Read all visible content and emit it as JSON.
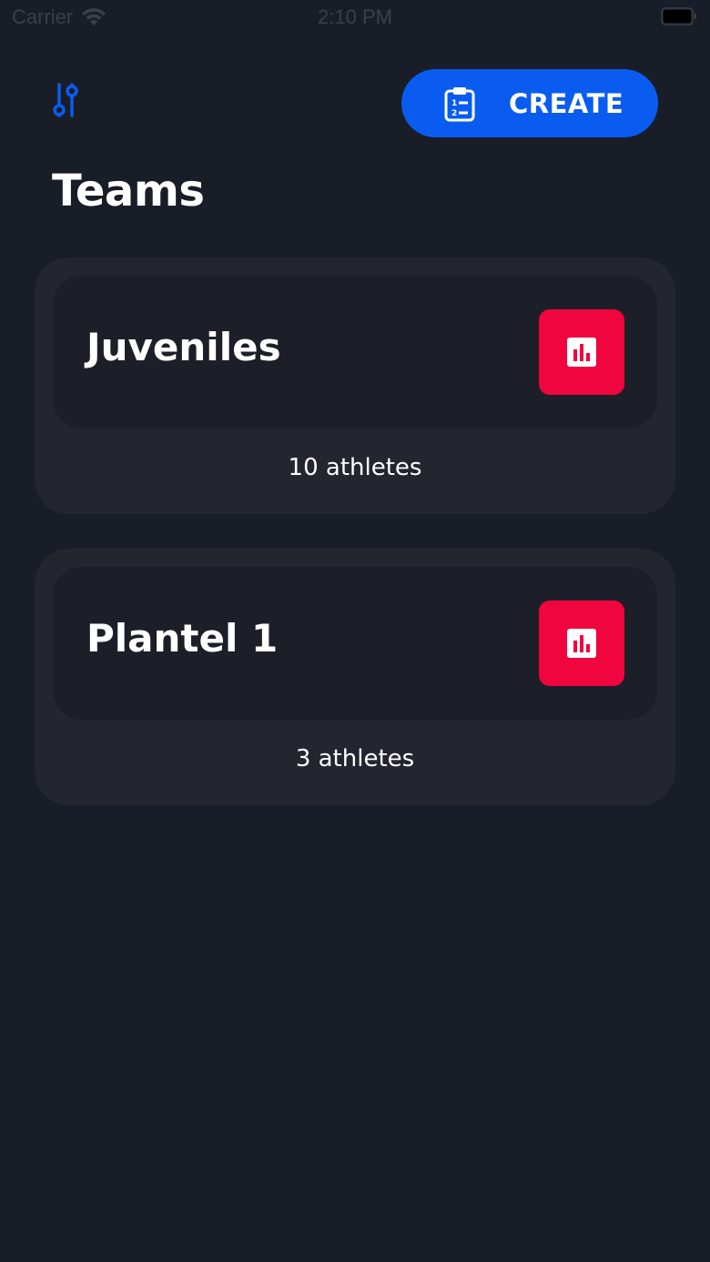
{
  "status_bar": {
    "carrier": "Carrier",
    "time": "2:10 PM"
  },
  "header": {
    "create_label": "CREATE",
    "accent_color": "#0a5cf0"
  },
  "page": {
    "title": "Teams"
  },
  "teams": [
    {
      "name": "Juveniles",
      "athletes": "10 athletes"
    },
    {
      "name": "Plantel 1",
      "athletes": "3 athletes"
    }
  ],
  "icons": {
    "filter": "sliders-icon",
    "create": "clipboard-list-icon",
    "stats": "bar-chart-icon"
  },
  "colors": {
    "background": "#191d27",
    "card": "#23262f",
    "card_inner": "#1c1f28",
    "stats_button": "#f0053f"
  }
}
